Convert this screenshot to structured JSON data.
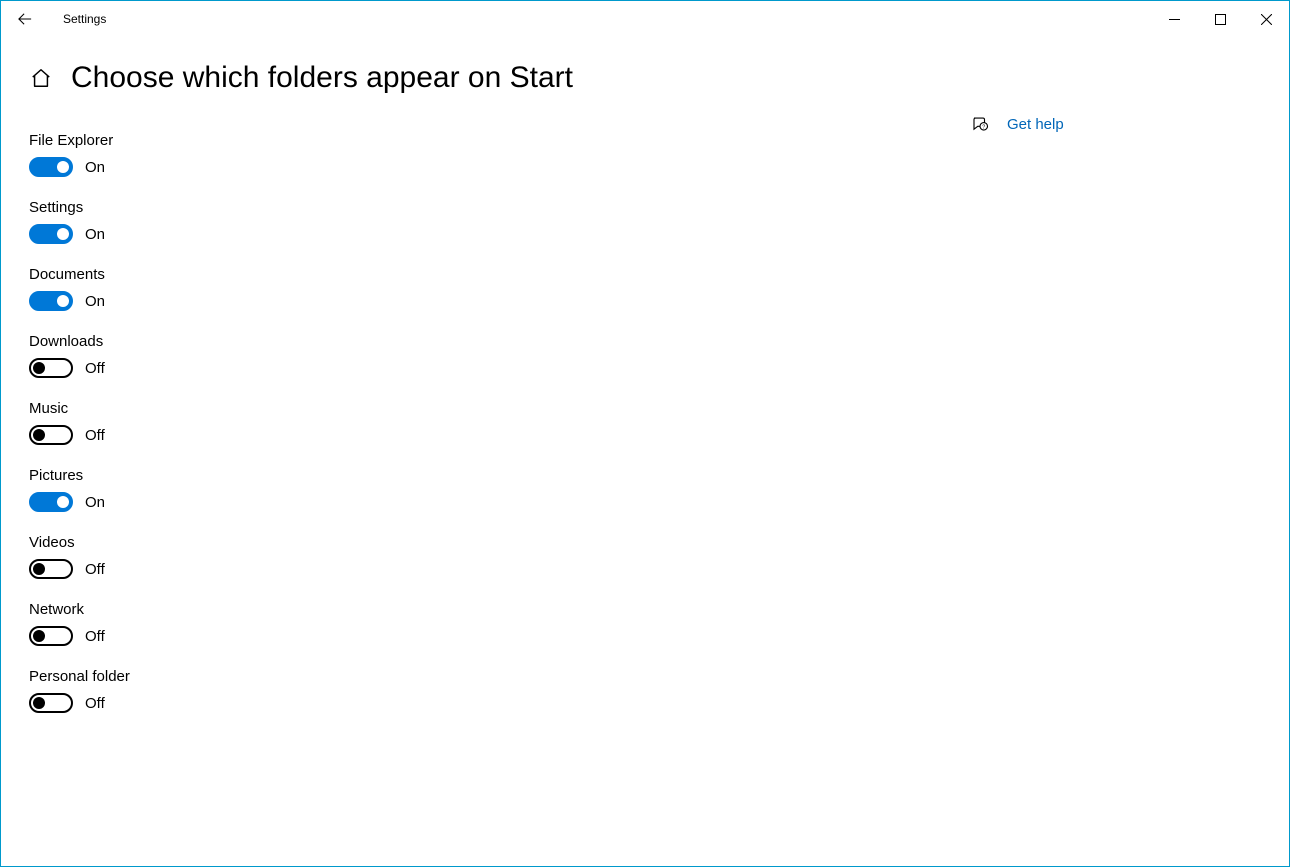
{
  "window": {
    "title": "Settings"
  },
  "page": {
    "title": "Choose which folders appear on Start"
  },
  "labels": {
    "on": "On",
    "off": "Off"
  },
  "folders": [
    {
      "name": "File Explorer",
      "enabled": true
    },
    {
      "name": "Settings",
      "enabled": true
    },
    {
      "name": "Documents",
      "enabled": true
    },
    {
      "name": "Downloads",
      "enabled": false
    },
    {
      "name": "Music",
      "enabled": false
    },
    {
      "name": "Pictures",
      "enabled": true
    },
    {
      "name": "Videos",
      "enabled": false
    },
    {
      "name": "Network",
      "enabled": false
    },
    {
      "name": "Personal folder",
      "enabled": false
    }
  ],
  "help": {
    "label": "Get help"
  }
}
